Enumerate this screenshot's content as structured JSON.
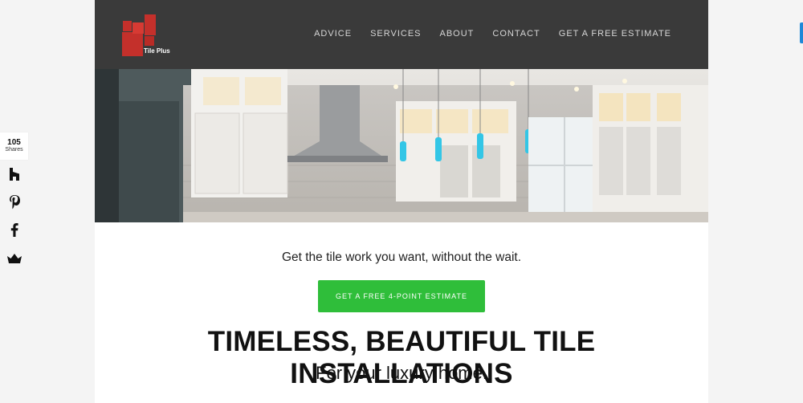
{
  "brand": {
    "name": "Tile Plus"
  },
  "nav": {
    "items": [
      "ADVICE",
      "SERVICES",
      "ABOUT",
      "CONTACT",
      "GET A FREE ESTIMATE"
    ]
  },
  "share": {
    "count": "105",
    "label": "Shares",
    "icons": [
      "houzz-icon",
      "pinterest-icon",
      "facebook-icon",
      "sumo-crown-icon"
    ]
  },
  "hero": {
    "tagline": "Get the tile work you want, without the wait.",
    "cta_label": "GET A FREE 4-POINT ESTIMATE"
  },
  "section": {
    "headline": "TIMELESS, BEAUTIFUL TILE INSTALLATIONS",
    "subhead": "For your luxury home."
  },
  "colors": {
    "header_bg": "#3a3a3a",
    "cta_green": "#2fbe3a",
    "logo_red": "#c4302b"
  }
}
